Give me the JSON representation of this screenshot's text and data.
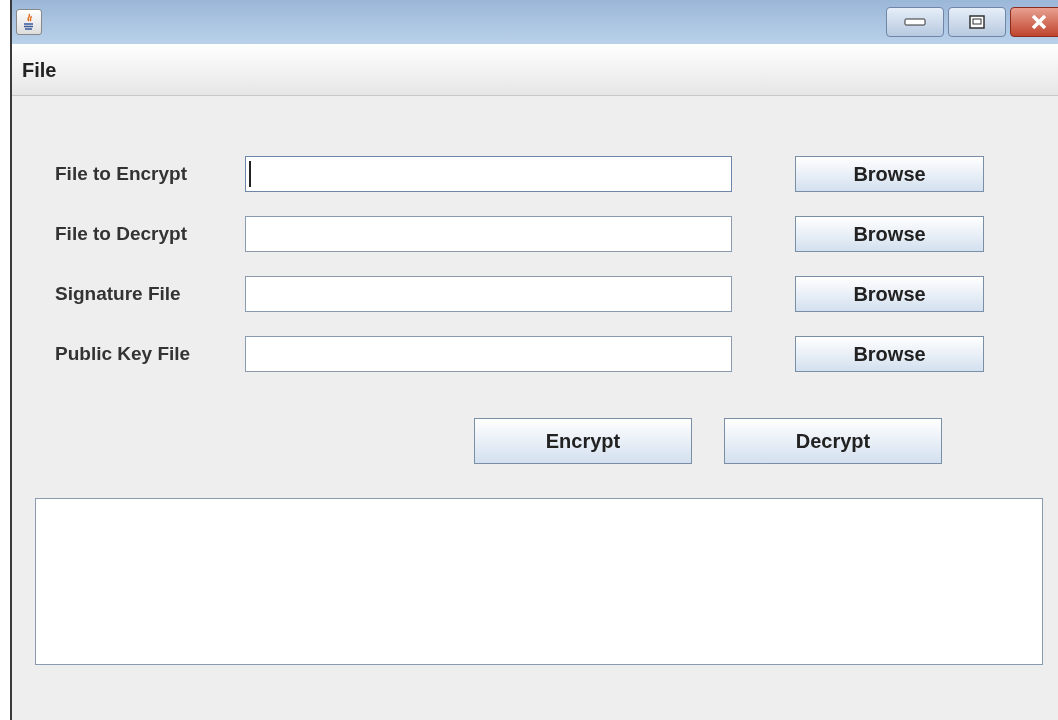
{
  "menu_bar": {
    "items": [
      "File"
    ]
  },
  "form": {
    "rows": [
      {
        "label": "File to Encrypt",
        "focused": true,
        "button": "Browse"
      },
      {
        "label": "File to Decrypt",
        "focused": false,
        "button": "Browse"
      },
      {
        "label": "Signature File",
        "focused": false,
        "button": "Browse"
      },
      {
        "label": "Public Key File",
        "focused": false,
        "button": "Browse"
      }
    ]
  },
  "actions": [
    "Encrypt",
    "Decrypt"
  ]
}
